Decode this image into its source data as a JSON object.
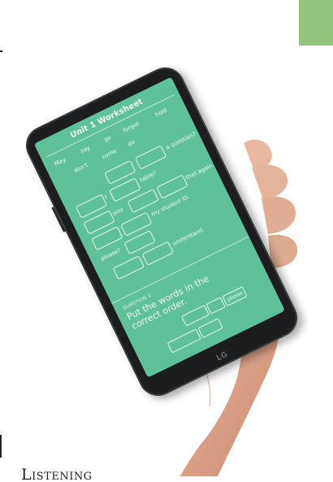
{
  "caption": "Listening",
  "colors": {
    "accent": "#92c47c",
    "screen": "#5fc199",
    "phone_body": "#1c1d1f"
  },
  "phone": {
    "brand": "LG"
  },
  "worksheet": {
    "title": "Unit 1 Worksheet",
    "word_bank": [
      "May",
      "say",
      "go",
      "forgot",
      "hold",
      "don't",
      "come",
      "do"
    ],
    "sentence_fragments": [
      "a question?",
      "I",
      "table?",
      "that again",
      "you",
      "my student ID.",
      "please?",
      "understand."
    ],
    "question_label": "QUESTION 2",
    "question_prompt": "Put the words in the correct order.",
    "answer_chip": "phone"
  }
}
